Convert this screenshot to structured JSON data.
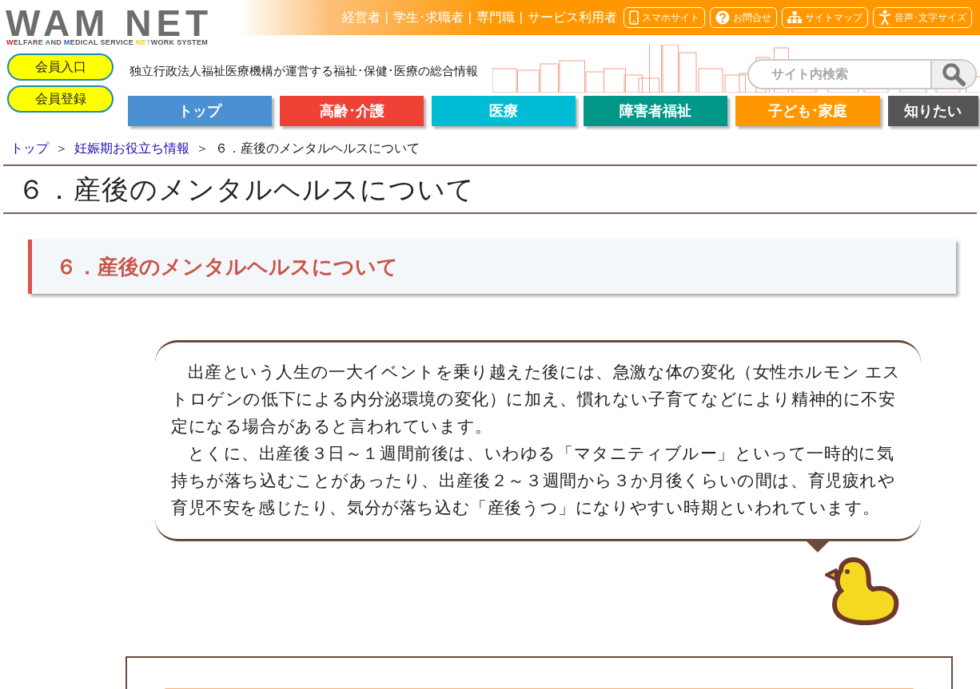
{
  "logo": {
    "text": "WAM NET",
    "tagline": [
      {
        "text": "W",
        "color": "#d7191c"
      },
      {
        "text": "ELFARE ",
        "color": "#555555"
      },
      {
        "text": "A",
        "color": "#1a9641"
      },
      {
        "text": "ND ",
        "color": "#555555"
      },
      {
        "text": "M",
        "color": "#2b6cc4"
      },
      {
        "text": "EDICAL SERVICE ",
        "color": "#555555"
      },
      {
        "text": "NE",
        "color": "#f2d21b"
      },
      {
        "text": "T",
        "color": "#8fd0ef"
      },
      {
        "text": "WORK SYSTEM",
        "color": "#555555"
      }
    ]
  },
  "top_links": [
    {
      "label": "経営者"
    },
    {
      "sep": "|",
      "label": "学生･求職者"
    },
    {
      "sep": "|",
      "label": "専門職"
    },
    {
      "sep": "|",
      "label": "サービス利用者"
    }
  ],
  "top_buttons": [
    {
      "kind": "phone",
      "label": "スマホサイト"
    },
    {
      "kind": "question",
      "label": "お問合せ"
    },
    {
      "kind": "sitemap",
      "label": "サイトマップ"
    },
    {
      "kind": "person",
      "label": "音声･文字サイズ"
    }
  ],
  "member_buttons": [
    "会員入口",
    "会員登録"
  ],
  "tagline": "独立行政法人福祉医療機構が運営する福祉･保健･医療の総合情報",
  "search": {
    "placeholder": "サイト内検索"
  },
  "nav": [
    {
      "label": "トップ",
      "color": "#4a90d2"
    },
    {
      "label": "高齢･介護",
      "color": "#ef4136"
    },
    {
      "label": "医療",
      "color": "#00bcd4"
    },
    {
      "label": "障害者福祉",
      "color": "#009688"
    },
    {
      "label": "子ども･家庭",
      "color": "#ff9800"
    },
    {
      "label": "知りたい",
      "color": "#555555"
    }
  ],
  "breadcrumb": [
    {
      "label": "トップ",
      "link": true
    },
    {
      "sep": "＞",
      "label": "妊娠期お役立ち情報",
      "link": true
    },
    {
      "sep": "＞",
      "label": "６．産後のメンタルヘルスについて",
      "link": false
    }
  ],
  "page_title": "６．産後のメンタルヘルスについて",
  "section_heading": "６．産後のメンタルヘルスについて",
  "bubble_paragraphs": [
    "出産という人生の一大イベントを乗り越えた後には、急激な体の変化（女性ホルモン エストロゲンの低下による内分泌環境の変化）に加え、慣れない子育てなどにより精神的に不安定になる場合があると言われています。",
    "とくに、出産後３日～１週間前後は、いわゆる「マタニティブルー」といって一時的に気持ちが落ち込むことがあったり、出産後２～３週間から３か月後くらいの間は、育児疲れや育児不安を感じたり、気分が落ち込む「産後うつ」になりやすい時期といわれています。"
  ]
}
